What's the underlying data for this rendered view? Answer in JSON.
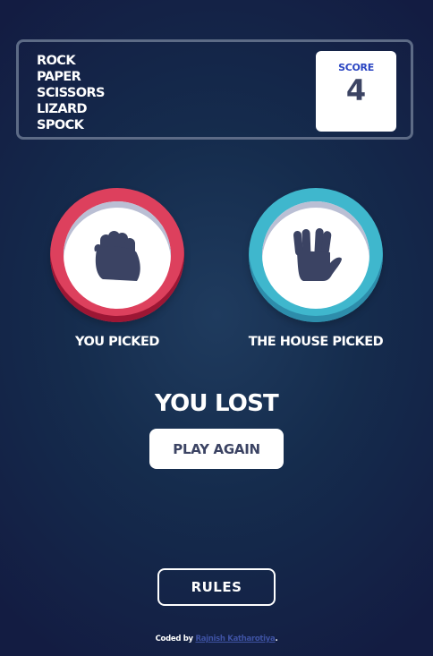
{
  "header": {
    "title_items": [
      "ROCK",
      "PAPER",
      "SCISSORS",
      "LIZARD",
      "SPOCK"
    ],
    "score_label": "SCORE",
    "score_value": "4"
  },
  "picks": {
    "you": {
      "label": "YOU PICKED",
      "choice": "rock",
      "icon": "rock-fist-icon",
      "ring_color": "#dd405d"
    },
    "house": {
      "label": "THE HOUSE PICKED",
      "choice": "spock",
      "icon": "spock-hand-icon",
      "ring_color": "#3fb7cd"
    }
  },
  "result": {
    "text": "YOU LOST",
    "play_again_label": "PLAY AGAIN"
  },
  "rules_label": "RULES",
  "attribution": {
    "prefix": "Coded by",
    "author": "Rajnish Katharotiya",
    "suffix": "."
  },
  "colors": {
    "background_dark": "#131c42",
    "background_light": "#1f3b5e",
    "header_outline": "#5d6b86",
    "score_label": "#2a45c2",
    "dark_text": "#3b4363",
    "link": "#3e52a3"
  }
}
